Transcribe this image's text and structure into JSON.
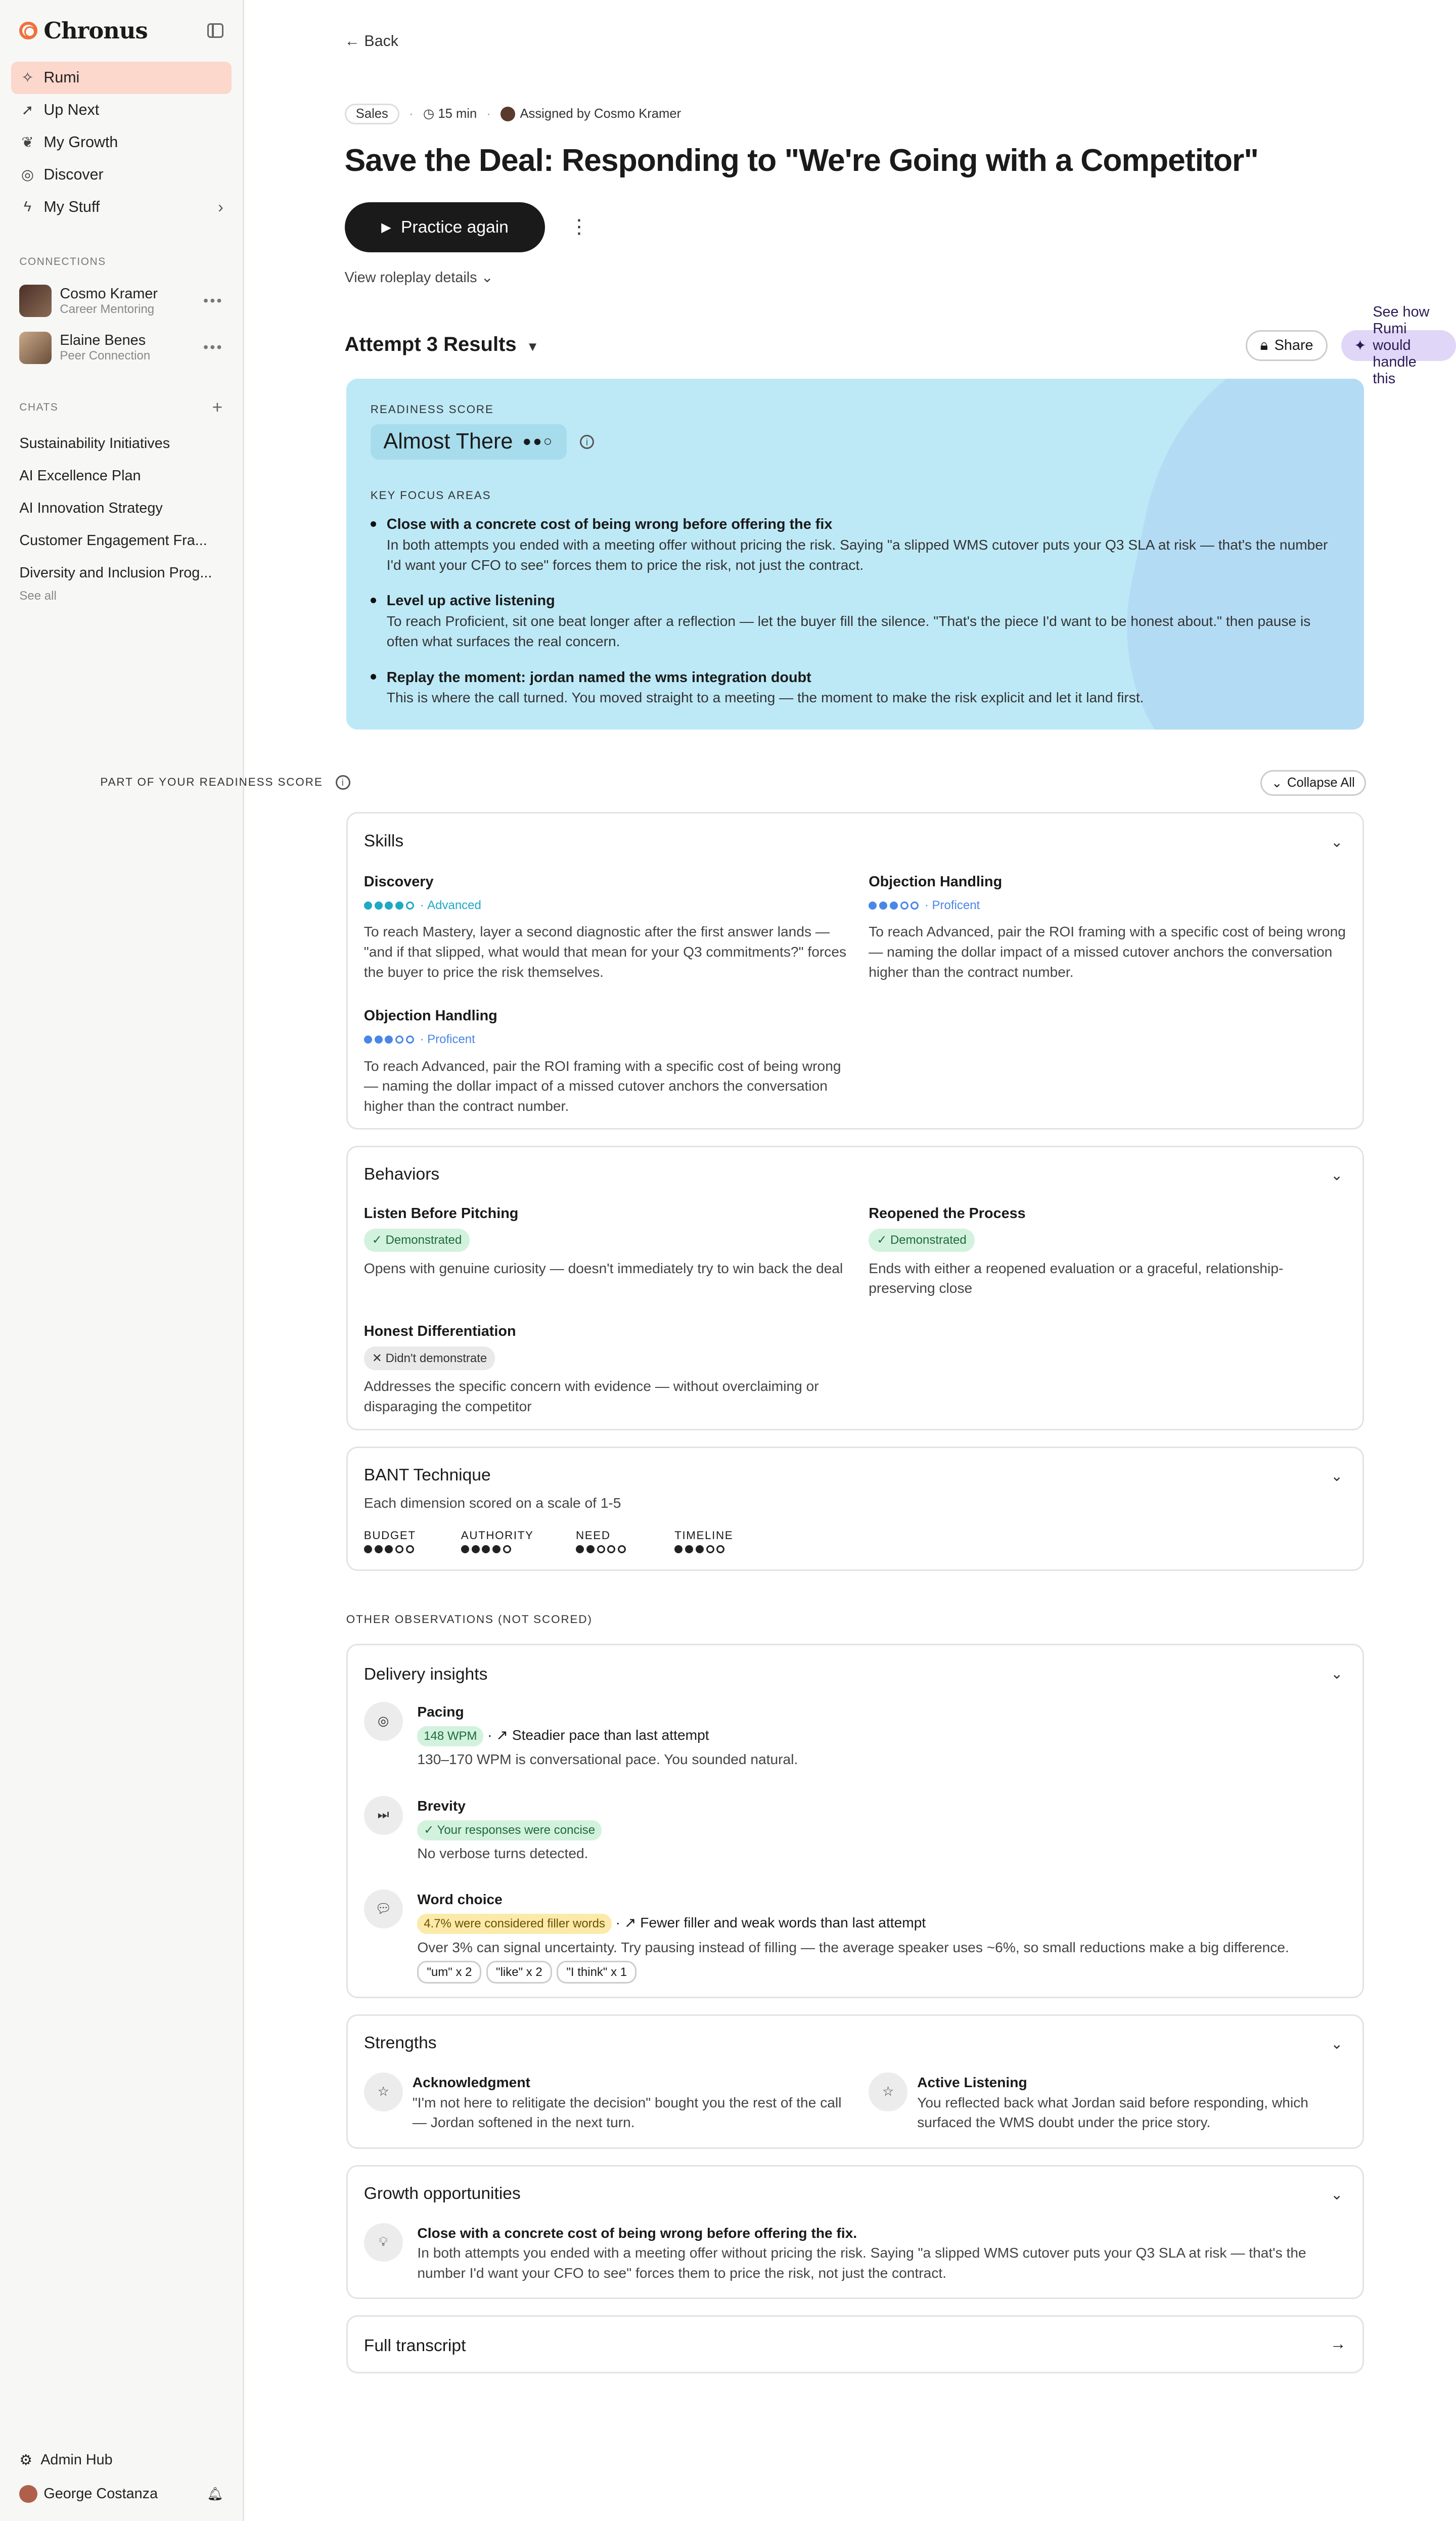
{
  "app": {
    "name": "Chronus"
  },
  "sidebar": {
    "nav": [
      {
        "label": "Rumi",
        "icon": "sparkle-icon"
      },
      {
        "label": "Up Next",
        "icon": "rocket-icon"
      },
      {
        "label": "My Growth",
        "icon": "sprout-icon"
      },
      {
        "label": "Discover",
        "icon": "compass-icon"
      },
      {
        "label": "My Stuff",
        "icon": "bolt-icon"
      }
    ],
    "connections_label": "CONNECTIONS",
    "connections": [
      {
        "name": "Cosmo Kramer",
        "role": "Career Mentoring"
      },
      {
        "name": "Elaine Benes",
        "role": "Peer Connection"
      }
    ],
    "chats_label": "CHATS",
    "chats": [
      "Sustainability Initiatives",
      "AI Excellence Plan",
      "AI Innovation Strategy",
      "Customer Engagement Fra...",
      "Diversity and Inclusion Prog..."
    ],
    "see_all": "See all",
    "admin": "Admin Hub",
    "user": "George Costanza"
  },
  "main": {
    "back": "Back",
    "meta": {
      "tag": "Sales",
      "duration": "15 min",
      "assigned": "Assigned by Cosmo Kramer"
    },
    "title": "Save the Deal: Responding to \"We're Going with a Competitor\"",
    "practice": "Practice again",
    "view_details": "View roleplay details",
    "attempt": "Attempt 3 Results",
    "share": "Share",
    "see_how": "See how Rumi would handle this",
    "readiness": {
      "label": "READINESS SCORE",
      "score": "Almost There",
      "focus_label": "KEY FOCUS AREAS",
      "focus": [
        {
          "title": "Close with a concrete cost of being wrong before offering the fix",
          "text": "In both attempts you ended with a meeting offer without pricing the risk. Saying \"a slipped WMS cutover puts your Q3 SLA at risk — that's the number I'd want your CFO to see\" forces them to price the risk, not just the contract."
        },
        {
          "title": "Level up active listening",
          "text": "To reach Proficient, sit one beat longer after a reflection — let the buyer fill the silence. \"That's the piece I'd want to be honest about.\" then pause is often what surfaces the real concern."
        },
        {
          "title": "Replay the moment: jordan named the wms integration doubt",
          "text": "This is where the call turned. You moved straight to a meeting — the moment to make the risk explicit and let it land first."
        }
      ]
    },
    "part_label": "PART OF YOUR READINESS SCORE",
    "collapse": "Collapse All",
    "skills": {
      "title": "Skills",
      "items": [
        {
          "name": "Discovery",
          "level": "Advanced",
          "filled": 4,
          "text": "To reach Mastery, layer a second diagnostic after the first answer lands — \"and if that slipped, what would that mean for your Q3 commitments?\" forces the buyer to price the risk themselves."
        },
        {
          "name": "Objection Handling",
          "level": "Proficent",
          "filled": 3,
          "text": "To reach Advanced, pair the ROI framing with a specific cost of being wrong — naming the dollar impact of a missed cutover anchors the conversation higher than the contract number."
        },
        {
          "name": "Objection Handling",
          "level": "Proficent",
          "filled": 3,
          "text": "To reach Advanced, pair the ROI framing with a specific cost of being wrong — naming the dollar impact of a missed cutover anchors the conversation higher than the contract number."
        }
      ]
    },
    "behaviors": {
      "title": "Behaviors",
      "items": [
        {
          "name": "Listen Before Pitching",
          "status": "Demonstrated",
          "text": "Opens with genuine curiosity — doesn't immediately try to win back the deal"
        },
        {
          "name": "Reopened the Process",
          "status": "Demonstrated",
          "text": "Ends with either a reopened evaluation or a graceful, relationship-preserving close"
        },
        {
          "name": "Honest Differentiation",
          "status": "Didn't demonstrate",
          "text": "Addresses the specific concern with evidence — without overclaiming or disparaging the competitor"
        }
      ]
    },
    "bant": {
      "title": "BANT Technique",
      "subtitle": "Each dimension scored on a scale of 1-5",
      "dims": [
        {
          "label": "BUDGET",
          "score": 3
        },
        {
          "label": "AUTHORITY",
          "score": 4
        },
        {
          "label": "NEED",
          "score": 2
        },
        {
          "label": "TIMELINE",
          "score": 3
        }
      ]
    },
    "obs_label": "OTHER OBSERVATIONS (NOT SCORED)",
    "delivery": {
      "title": "Delivery insights",
      "pacing": {
        "title": "Pacing",
        "tag": "148 WPM",
        "trend": "Steadier pace than last attempt",
        "text": "130–170 WPM is conversational pace. You sounded natural."
      },
      "brevity": {
        "title": "Brevity",
        "tag": "Your responses were concise",
        "text": "No verbose turns detected."
      },
      "word": {
        "title": "Word choice",
        "tag": "4.7% were considered filler words",
        "trend": "Fewer filler and weak words than last attempt",
        "text": "Over 3% can signal uncertainty. Try pausing instead of filling — the average speaker uses ~6%, so small reductions make a big difference.",
        "chips": [
          "\"um\" x 2",
          "\"like\" x 2",
          "\"I think\" x 1"
        ]
      }
    },
    "strengths": {
      "title": "Strengths",
      "items": [
        {
          "name": "Acknowledgment",
          "text": "\"I'm not here to relitigate the decision\" bought you the rest of the call — Jordan softened in the next turn."
        },
        {
          "name": "Active Listening",
          "text": "You reflected back what Jordan said before responding, which surfaced the WMS doubt under the price story."
        }
      ]
    },
    "growth": {
      "title": "Growth opportunities",
      "item": {
        "name": "Close with a concrete cost of being wrong before offering the fix.",
        "text": "In both attempts you ended with a meeting offer without pricing the risk. Saying \"a slipped WMS cutover puts your Q3 SLA at risk — that's the number I'd want your CFO to see\" forces them to price the risk, not just the contract."
      }
    },
    "transcript": "Full transcript"
  }
}
